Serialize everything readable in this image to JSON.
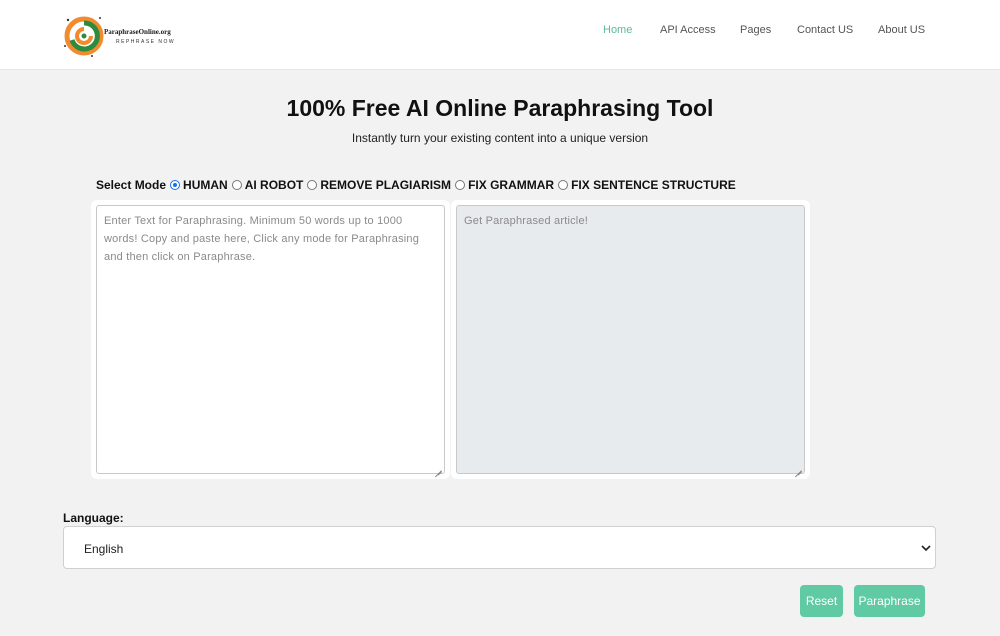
{
  "header": {
    "logo": {
      "name": "ParaphraseOnline.org",
      "tagline": "REPHRASE NOW"
    },
    "nav": [
      {
        "label": "Home",
        "active": true
      },
      {
        "label": "API Access",
        "active": false
      },
      {
        "label": "Pages",
        "active": false
      },
      {
        "label": "Contact US",
        "active": false
      },
      {
        "label": "About US",
        "active": false
      }
    ]
  },
  "main": {
    "title": "100% Free AI Online Paraphrasing Tool",
    "subtitle": "Instantly turn your existing content into a unique version"
  },
  "modes": {
    "label": "Select Mode",
    "options": [
      {
        "label": "HUMAN",
        "checked": true
      },
      {
        "label": "AI ROBOT",
        "checked": false
      },
      {
        "label": "REMOVE PLAGIARISM",
        "checked": false
      },
      {
        "label": "FIX GRAMMAR",
        "checked": false
      },
      {
        "label": "FIX SENTENCE STRUCTURE",
        "checked": false
      }
    ]
  },
  "input": {
    "placeholder": "Enter Text for Paraphrasing. Minimum 50 words up to 1000 words! Copy and paste here, Click any mode for Paraphrasing and then click on Paraphrase.",
    "value": ""
  },
  "output": {
    "placeholder": "Get Paraphrased article!",
    "value": ""
  },
  "language": {
    "label": "Language:",
    "selected": "English"
  },
  "buttons": {
    "reset": "Reset",
    "paraphrase": "Paraphrase"
  },
  "colors": {
    "accent": "#5fcaa4",
    "nav_active": "#5cb99a",
    "radio_checked": "#1a73e8",
    "page_background": "#f2f2f2",
    "output_background": "#e8ebee"
  }
}
